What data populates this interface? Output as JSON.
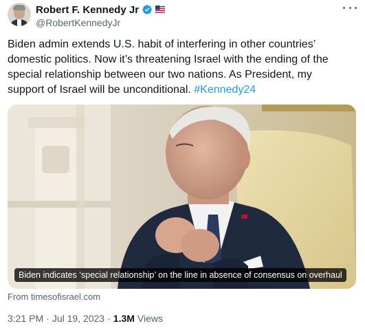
{
  "author": {
    "display_name": "Robert F. Kennedy Jr",
    "handle": "@RobertKennedyJr",
    "verified_icon": "verified-badge-icon",
    "affiliate_icon": "us-flag-icon"
  },
  "tweet": {
    "text": "Biden admin extends U.S. habit of interfering in other countries’ domestic politics. Now it’s threatening Israel with the ending of the special relationship between our two nations. As President, my support of Israel will be unconditional. ",
    "hashtag": "#Kennedy24"
  },
  "card": {
    "caption": "Biden indicates ‘special relationship’ on the line in absence of consensus on overhaul",
    "source": "From timesofisrael.com"
  },
  "meta": {
    "time": "3:21 PM",
    "separator": "·",
    "date": "Jul 19, 2023",
    "views_count": "1.3M",
    "views_label": "Views"
  },
  "colors": {
    "accent": "#1d9bf0",
    "text": "#0f1419",
    "secondary": "#536471"
  }
}
